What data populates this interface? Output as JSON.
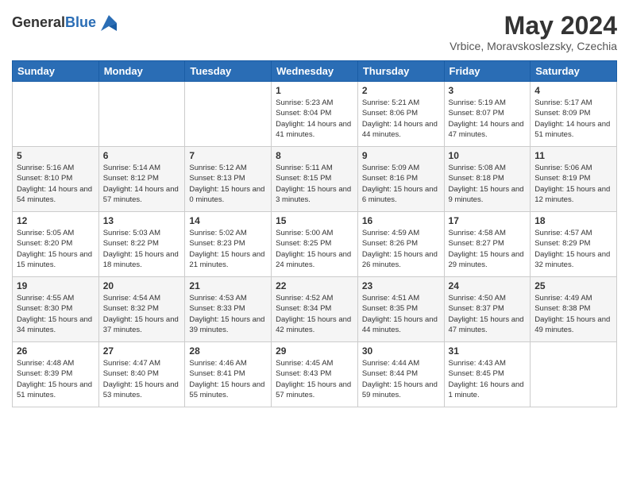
{
  "logo": {
    "general": "General",
    "blue": "Blue"
  },
  "title": "May 2024",
  "location": "Vrbice, Moravskoslezsky, Czechia",
  "days_of_week": [
    "Sunday",
    "Monday",
    "Tuesday",
    "Wednesday",
    "Thursday",
    "Friday",
    "Saturday"
  ],
  "weeks": [
    [
      {
        "day": "",
        "info": ""
      },
      {
        "day": "",
        "info": ""
      },
      {
        "day": "",
        "info": ""
      },
      {
        "day": "1",
        "info": "Sunrise: 5:23 AM\nSunset: 8:04 PM\nDaylight: 14 hours\nand 41 minutes."
      },
      {
        "day": "2",
        "info": "Sunrise: 5:21 AM\nSunset: 8:06 PM\nDaylight: 14 hours\nand 44 minutes."
      },
      {
        "day": "3",
        "info": "Sunrise: 5:19 AM\nSunset: 8:07 PM\nDaylight: 14 hours\nand 47 minutes."
      },
      {
        "day": "4",
        "info": "Sunrise: 5:17 AM\nSunset: 8:09 PM\nDaylight: 14 hours\nand 51 minutes."
      }
    ],
    [
      {
        "day": "5",
        "info": "Sunrise: 5:16 AM\nSunset: 8:10 PM\nDaylight: 14 hours\nand 54 minutes."
      },
      {
        "day": "6",
        "info": "Sunrise: 5:14 AM\nSunset: 8:12 PM\nDaylight: 14 hours\nand 57 minutes."
      },
      {
        "day": "7",
        "info": "Sunrise: 5:12 AM\nSunset: 8:13 PM\nDaylight: 15 hours\nand 0 minutes."
      },
      {
        "day": "8",
        "info": "Sunrise: 5:11 AM\nSunset: 8:15 PM\nDaylight: 15 hours\nand 3 minutes."
      },
      {
        "day": "9",
        "info": "Sunrise: 5:09 AM\nSunset: 8:16 PM\nDaylight: 15 hours\nand 6 minutes."
      },
      {
        "day": "10",
        "info": "Sunrise: 5:08 AM\nSunset: 8:18 PM\nDaylight: 15 hours\nand 9 minutes."
      },
      {
        "day": "11",
        "info": "Sunrise: 5:06 AM\nSunset: 8:19 PM\nDaylight: 15 hours\nand 12 minutes."
      }
    ],
    [
      {
        "day": "12",
        "info": "Sunrise: 5:05 AM\nSunset: 8:20 PM\nDaylight: 15 hours\nand 15 minutes."
      },
      {
        "day": "13",
        "info": "Sunrise: 5:03 AM\nSunset: 8:22 PM\nDaylight: 15 hours\nand 18 minutes."
      },
      {
        "day": "14",
        "info": "Sunrise: 5:02 AM\nSunset: 8:23 PM\nDaylight: 15 hours\nand 21 minutes."
      },
      {
        "day": "15",
        "info": "Sunrise: 5:00 AM\nSunset: 8:25 PM\nDaylight: 15 hours\nand 24 minutes."
      },
      {
        "day": "16",
        "info": "Sunrise: 4:59 AM\nSunset: 8:26 PM\nDaylight: 15 hours\nand 26 minutes."
      },
      {
        "day": "17",
        "info": "Sunrise: 4:58 AM\nSunset: 8:27 PM\nDaylight: 15 hours\nand 29 minutes."
      },
      {
        "day": "18",
        "info": "Sunrise: 4:57 AM\nSunset: 8:29 PM\nDaylight: 15 hours\nand 32 minutes."
      }
    ],
    [
      {
        "day": "19",
        "info": "Sunrise: 4:55 AM\nSunset: 8:30 PM\nDaylight: 15 hours\nand 34 minutes."
      },
      {
        "day": "20",
        "info": "Sunrise: 4:54 AM\nSunset: 8:32 PM\nDaylight: 15 hours\nand 37 minutes."
      },
      {
        "day": "21",
        "info": "Sunrise: 4:53 AM\nSunset: 8:33 PM\nDaylight: 15 hours\nand 39 minutes."
      },
      {
        "day": "22",
        "info": "Sunrise: 4:52 AM\nSunset: 8:34 PM\nDaylight: 15 hours\nand 42 minutes."
      },
      {
        "day": "23",
        "info": "Sunrise: 4:51 AM\nSunset: 8:35 PM\nDaylight: 15 hours\nand 44 minutes."
      },
      {
        "day": "24",
        "info": "Sunrise: 4:50 AM\nSunset: 8:37 PM\nDaylight: 15 hours\nand 47 minutes."
      },
      {
        "day": "25",
        "info": "Sunrise: 4:49 AM\nSunset: 8:38 PM\nDaylight: 15 hours\nand 49 minutes."
      }
    ],
    [
      {
        "day": "26",
        "info": "Sunrise: 4:48 AM\nSunset: 8:39 PM\nDaylight: 15 hours\nand 51 minutes."
      },
      {
        "day": "27",
        "info": "Sunrise: 4:47 AM\nSunset: 8:40 PM\nDaylight: 15 hours\nand 53 minutes."
      },
      {
        "day": "28",
        "info": "Sunrise: 4:46 AM\nSunset: 8:41 PM\nDaylight: 15 hours\nand 55 minutes."
      },
      {
        "day": "29",
        "info": "Sunrise: 4:45 AM\nSunset: 8:43 PM\nDaylight: 15 hours\nand 57 minutes."
      },
      {
        "day": "30",
        "info": "Sunrise: 4:44 AM\nSunset: 8:44 PM\nDaylight: 15 hours\nand 59 minutes."
      },
      {
        "day": "31",
        "info": "Sunrise: 4:43 AM\nSunset: 8:45 PM\nDaylight: 16 hours\nand 1 minute."
      },
      {
        "day": "",
        "info": ""
      }
    ]
  ]
}
